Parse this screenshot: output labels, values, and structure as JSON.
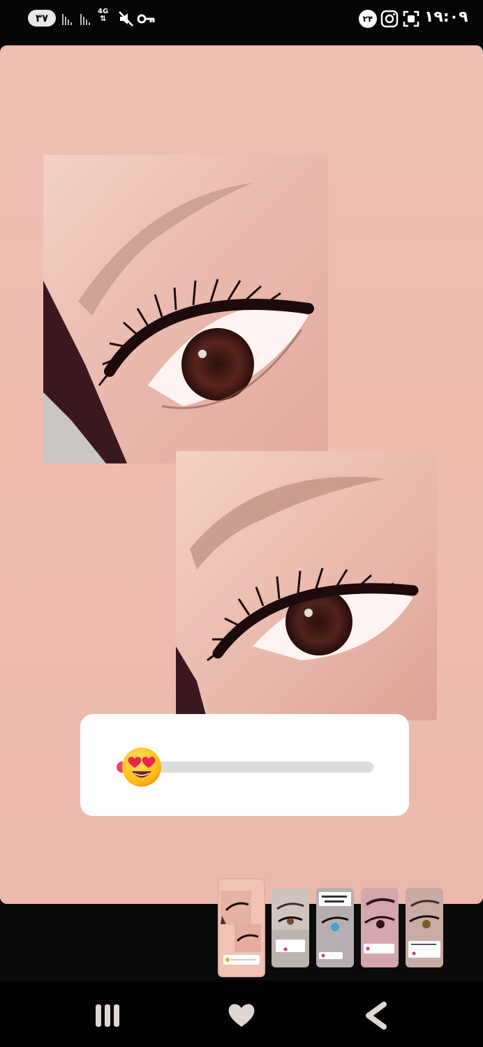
{
  "status_bar": {
    "battery": "۳۷",
    "network": "4G",
    "notification_count": "۲۴",
    "time": "۱۹:۰۹"
  },
  "story": {
    "slider_emoji": "heart-eyes-emoji",
    "slider_value": 0.05
  },
  "thumbnails": [
    {
      "name": "story-thumb-1",
      "active": true
    },
    {
      "name": "story-thumb-2",
      "active": false
    },
    {
      "name": "story-thumb-3",
      "active": false
    },
    {
      "name": "story-thumb-4",
      "active": false
    },
    {
      "name": "story-thumb-5",
      "active": false
    }
  ],
  "nav": {
    "recents": "recents-icon",
    "home": "heart-home-icon",
    "back": "back-icon"
  },
  "colors": {
    "story_background": "#ecbcad",
    "slider_fill": "#e83a6e"
  }
}
